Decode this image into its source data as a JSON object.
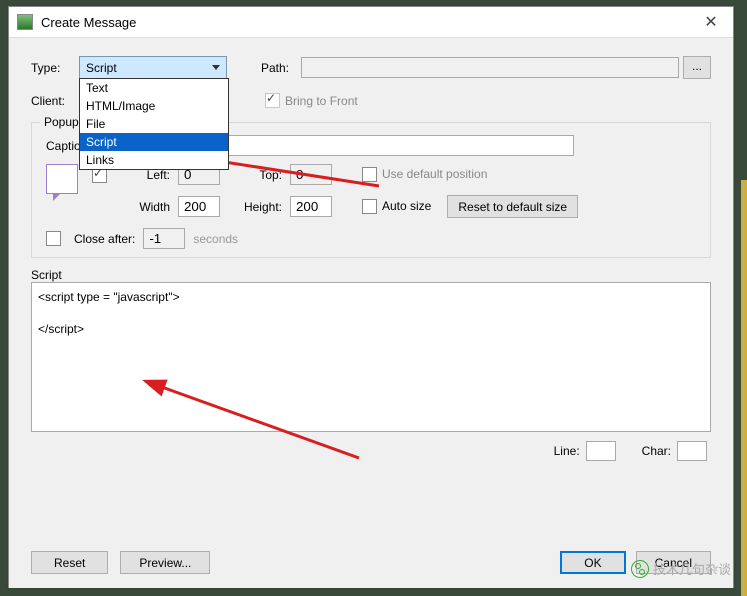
{
  "window": {
    "title": "Create Message"
  },
  "topRow": {
    "typeLabel": "Type:",
    "typeSelected": "Script",
    "typeOptions": [
      "Text",
      "HTML/Image",
      "File",
      "Script",
      "Links"
    ],
    "pathLabel": "Path:",
    "pathValue": "",
    "browseLabel": "..."
  },
  "clientRow": {
    "clientLabel": "Client:",
    "btfLabel": "Bring to Front"
  },
  "popup": {
    "legend": "Popup Message properties:",
    "captionLabel": "Caption:",
    "captionValue": "",
    "leftLabel": "Left:",
    "left": "0",
    "topLabel": "Top:",
    "top": "0",
    "useDefaultPos": "Use default position",
    "widthLabel": "Width",
    "width": "200",
    "heightLabel": "Height:",
    "height": "200",
    "autoSize": "Auto size",
    "resetSize": "Reset to default size",
    "closeAfterLabel": "Close after:",
    "closeAfter": "-1",
    "seconds": "seconds"
  },
  "script": {
    "label": "Script",
    "content": "<script type = \"javascript\">\n\n</script>"
  },
  "status": {
    "lineLabel": "Line:",
    "line": "",
    "charLabel": "Char:",
    "char": ""
  },
  "footer": {
    "reset": "Reset",
    "preview": "Preview...",
    "ok": "OK",
    "cancel": "Cancel"
  },
  "watermark": "技术几句杂谈"
}
